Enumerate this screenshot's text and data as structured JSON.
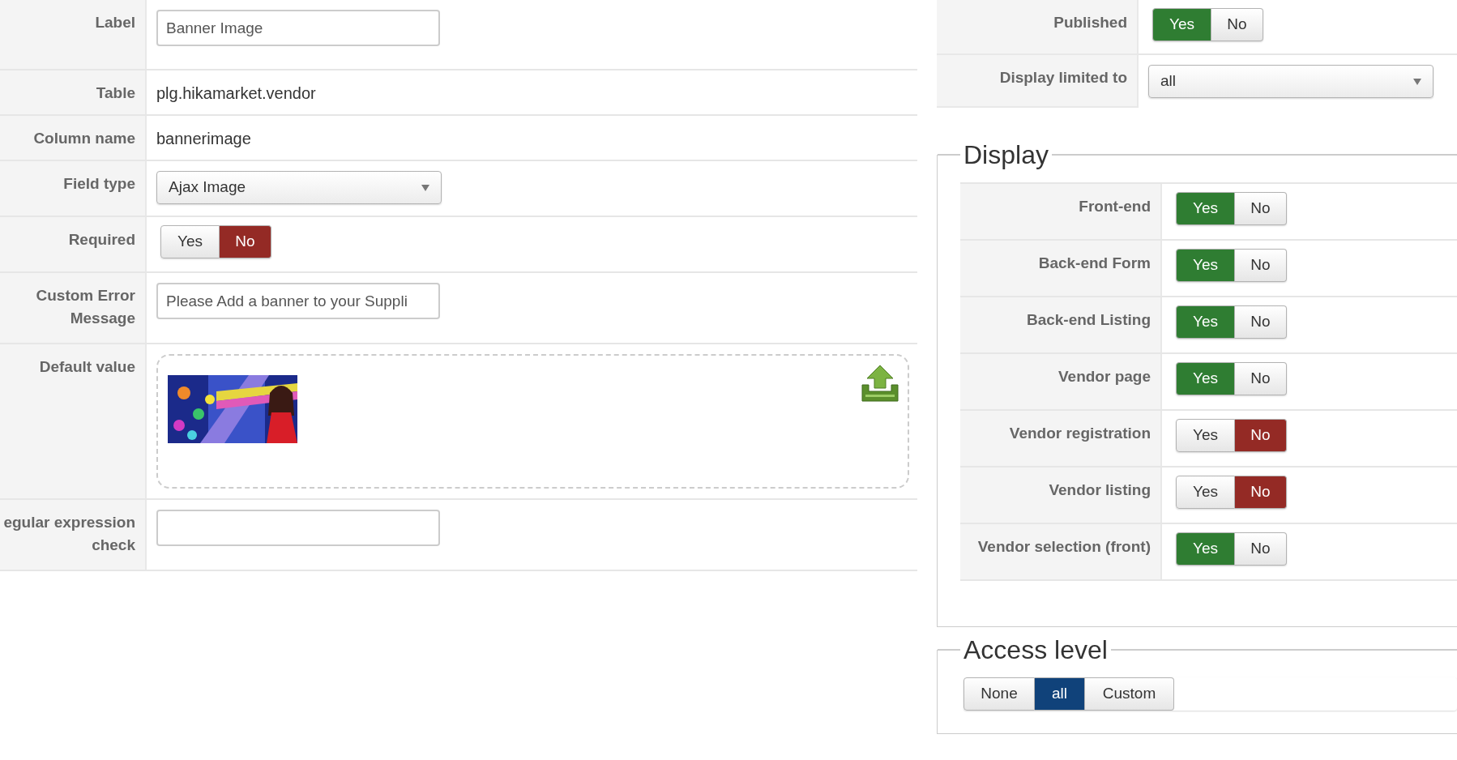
{
  "field_form": {
    "rows": [
      {
        "label": "Label",
        "kind": "text_input",
        "value": "Banner Image"
      },
      {
        "label": "Table",
        "kind": "text",
        "value": "plg.hikamarket.vendor"
      },
      {
        "label": "Column name",
        "kind": "text",
        "value": "bannerimage"
      },
      {
        "label": "Field type",
        "kind": "select",
        "value": "Ajax Image"
      },
      {
        "label": "Required",
        "kind": "toggle",
        "options": [
          {
            "label": "Yes",
            "selected": false
          },
          {
            "label": "No",
            "selected": true
          }
        ]
      },
      {
        "label": "Custom Error Message",
        "kind": "text_input",
        "value": "Please Add a banner to your Suppli"
      },
      {
        "label": "Default value",
        "kind": "image_upload"
      },
      {
        "label": "egular expression check",
        "kind": "text_input"
      }
    ]
  },
  "settings": {
    "rows": [
      {
        "label": "Published",
        "kind": "toggle",
        "options": [
          {
            "label": "Yes",
            "selected": true
          },
          {
            "label": "No",
            "selected": false
          }
        ]
      },
      {
        "label": "Display limited to",
        "kind": "select",
        "value": "all"
      }
    ]
  },
  "display": {
    "title": "Display",
    "rows": [
      {
        "label": "Front-end",
        "kind": "toggle",
        "options": [
          {
            "label": "Yes",
            "selected": true
          },
          {
            "label": "No",
            "selected": false
          }
        ]
      },
      {
        "label": "Back-end Form",
        "kind": "toggle",
        "options": [
          {
            "label": "Yes",
            "selected": true
          },
          {
            "label": "No",
            "selected": false
          }
        ]
      },
      {
        "label": "Back-end Listing",
        "kind": "toggle",
        "options": [
          {
            "label": "Yes",
            "selected": true
          },
          {
            "label": "No",
            "selected": false
          }
        ]
      },
      {
        "label": "Vendor page",
        "kind": "toggle",
        "options": [
          {
            "label": "Yes",
            "selected": true
          },
          {
            "label": "No",
            "selected": false
          }
        ]
      },
      {
        "label": "Vendor registration",
        "kind": "toggle",
        "options": [
          {
            "label": "Yes",
            "selected": false
          },
          {
            "label": "No",
            "selected": true
          }
        ]
      },
      {
        "label": "Vendor listing",
        "kind": "toggle",
        "options": [
          {
            "label": "Yes",
            "selected": false
          },
          {
            "label": "No",
            "selected": true
          }
        ]
      },
      {
        "label": "Vendor selection (front)",
        "kind": "toggle",
        "options": [
          {
            "label": "Yes",
            "selected": true
          },
          {
            "label": "No",
            "selected": false
          }
        ]
      }
    ]
  },
  "access_level": {
    "title": "Access level",
    "options": [
      {
        "label": "None",
        "selected": false
      },
      {
        "label": "all",
        "selected": true
      },
      {
        "label": "Custom",
        "selected": false
      }
    ]
  }
}
